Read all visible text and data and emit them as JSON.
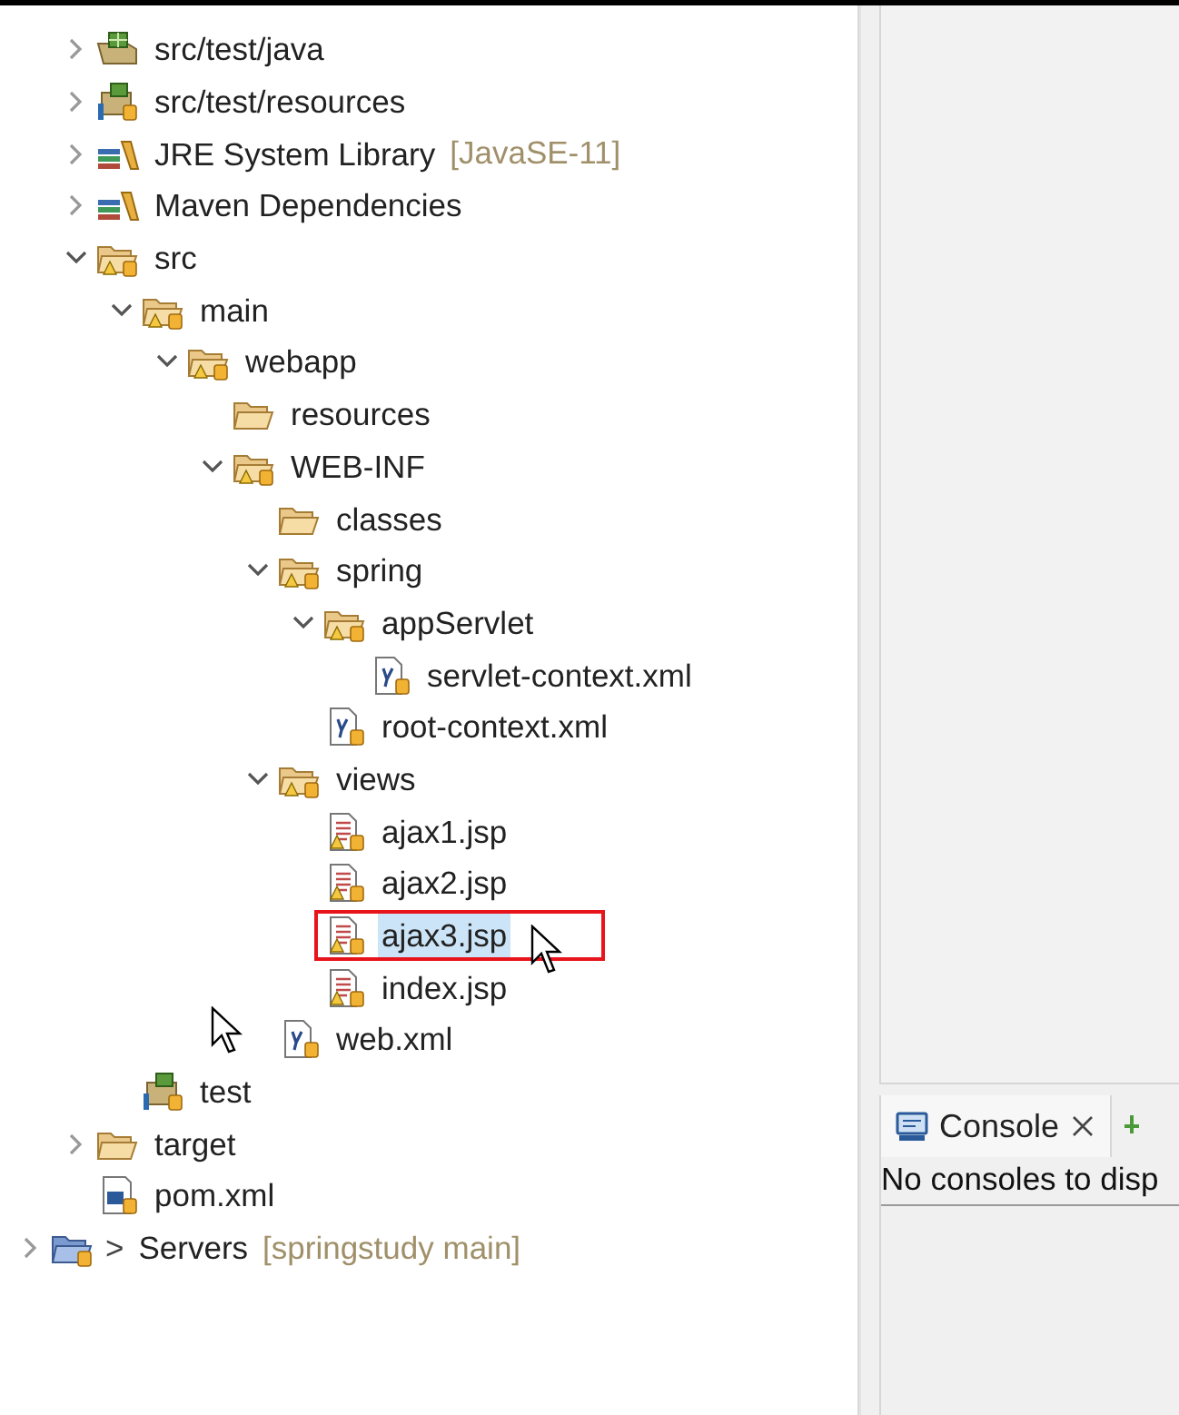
{
  "project_explorer": {
    "tree": [
      {
        "label": "src/test/java",
        "kind": "src_folder",
        "expanded": false,
        "selected": false
      },
      {
        "label": "src/test/resources",
        "kind": "res_folder",
        "expanded": false,
        "selected": false
      },
      {
        "label": "JRE System Library",
        "decoration": "[JavaSE-11]",
        "kind": "library",
        "expanded": false,
        "selected": false
      },
      {
        "label": "Maven Dependencies",
        "kind": "library",
        "expanded": false,
        "selected": false
      },
      {
        "label": "src",
        "kind": "folder",
        "expanded": true,
        "selected": false,
        "children": [
          {
            "label": "main",
            "kind": "folder",
            "expanded": true,
            "selected": false,
            "children": [
              {
                "label": "webapp",
                "kind": "folder",
                "expanded": true,
                "selected": false,
                "children": [
                  {
                    "label": "resources",
                    "kind": "plain_folder",
                    "selected": false
                  },
                  {
                    "label": "WEB-INF",
                    "kind": "folder",
                    "expanded": true,
                    "selected": false,
                    "children": [
                      {
                        "label": "classes",
                        "kind": "plain_folder",
                        "selected": false
                      },
                      {
                        "label": "spring",
                        "kind": "folder",
                        "expanded": true,
                        "selected": false,
                        "children": [
                          {
                            "label": "appServlet",
                            "kind": "folder",
                            "expanded": true,
                            "selected": false,
                            "children": [
                              {
                                "label": "servlet-context.xml",
                                "kind": "xml",
                                "selected": false
                              }
                            ]
                          },
                          {
                            "label": "root-context.xml",
                            "kind": "xml",
                            "selected": false
                          }
                        ]
                      },
                      {
                        "label": "views",
                        "kind": "folder",
                        "expanded": true,
                        "selected": false,
                        "children": [
                          {
                            "label": "ajax1.jsp",
                            "kind": "jsp",
                            "selected": false
                          },
                          {
                            "label": "ajax2.jsp",
                            "kind": "jsp",
                            "selected": false
                          },
                          {
                            "label": "ajax3.jsp",
                            "kind": "jsp",
                            "selected": true
                          },
                          {
                            "label": "index.jsp",
                            "kind": "jsp",
                            "selected": false
                          }
                        ]
                      },
                      {
                        "label": "web.xml",
                        "kind": "xml",
                        "selected": false
                      }
                    ]
                  }
                ]
              }
            ]
          },
          {
            "label": "test",
            "kind": "res_folder",
            "selected": false
          }
        ]
      },
      {
        "label": "target",
        "kind": "plain_folder",
        "expanded": false,
        "selected": false
      },
      {
        "label": "pom.xml",
        "kind": "pom",
        "selected": false
      }
    ],
    "servers": {
      "prefix": ">",
      "label": "Servers",
      "decoration": "[springstudy main]",
      "kind": "project",
      "expanded": false,
      "selected": false
    }
  },
  "console": {
    "tabs": [
      {
        "label": "Console",
        "selected": true
      }
    ],
    "message": "No consoles to disp"
  }
}
